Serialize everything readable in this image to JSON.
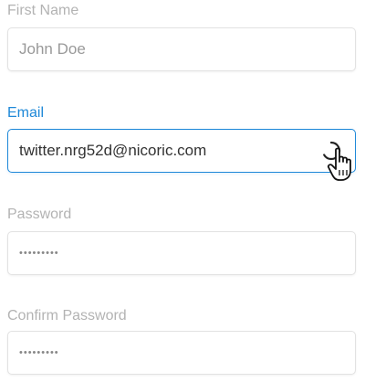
{
  "form": {
    "first_name": {
      "label": "First Name",
      "value": "John Doe"
    },
    "email": {
      "label": "Email",
      "value": "twitter.nrg52d@nicoric.com"
    },
    "password": {
      "label": "Password",
      "value": "•••••••••"
    },
    "confirm_password": {
      "label": "Confirm Password",
      "value": "•••••••••"
    }
  },
  "colors": {
    "accent": "#1e88d8",
    "label_muted": "#b3b3b3",
    "border": "#e2e2e2"
  },
  "icons": {
    "email_status": "spinner-icon",
    "cursor": "hand-cursor-icon"
  }
}
